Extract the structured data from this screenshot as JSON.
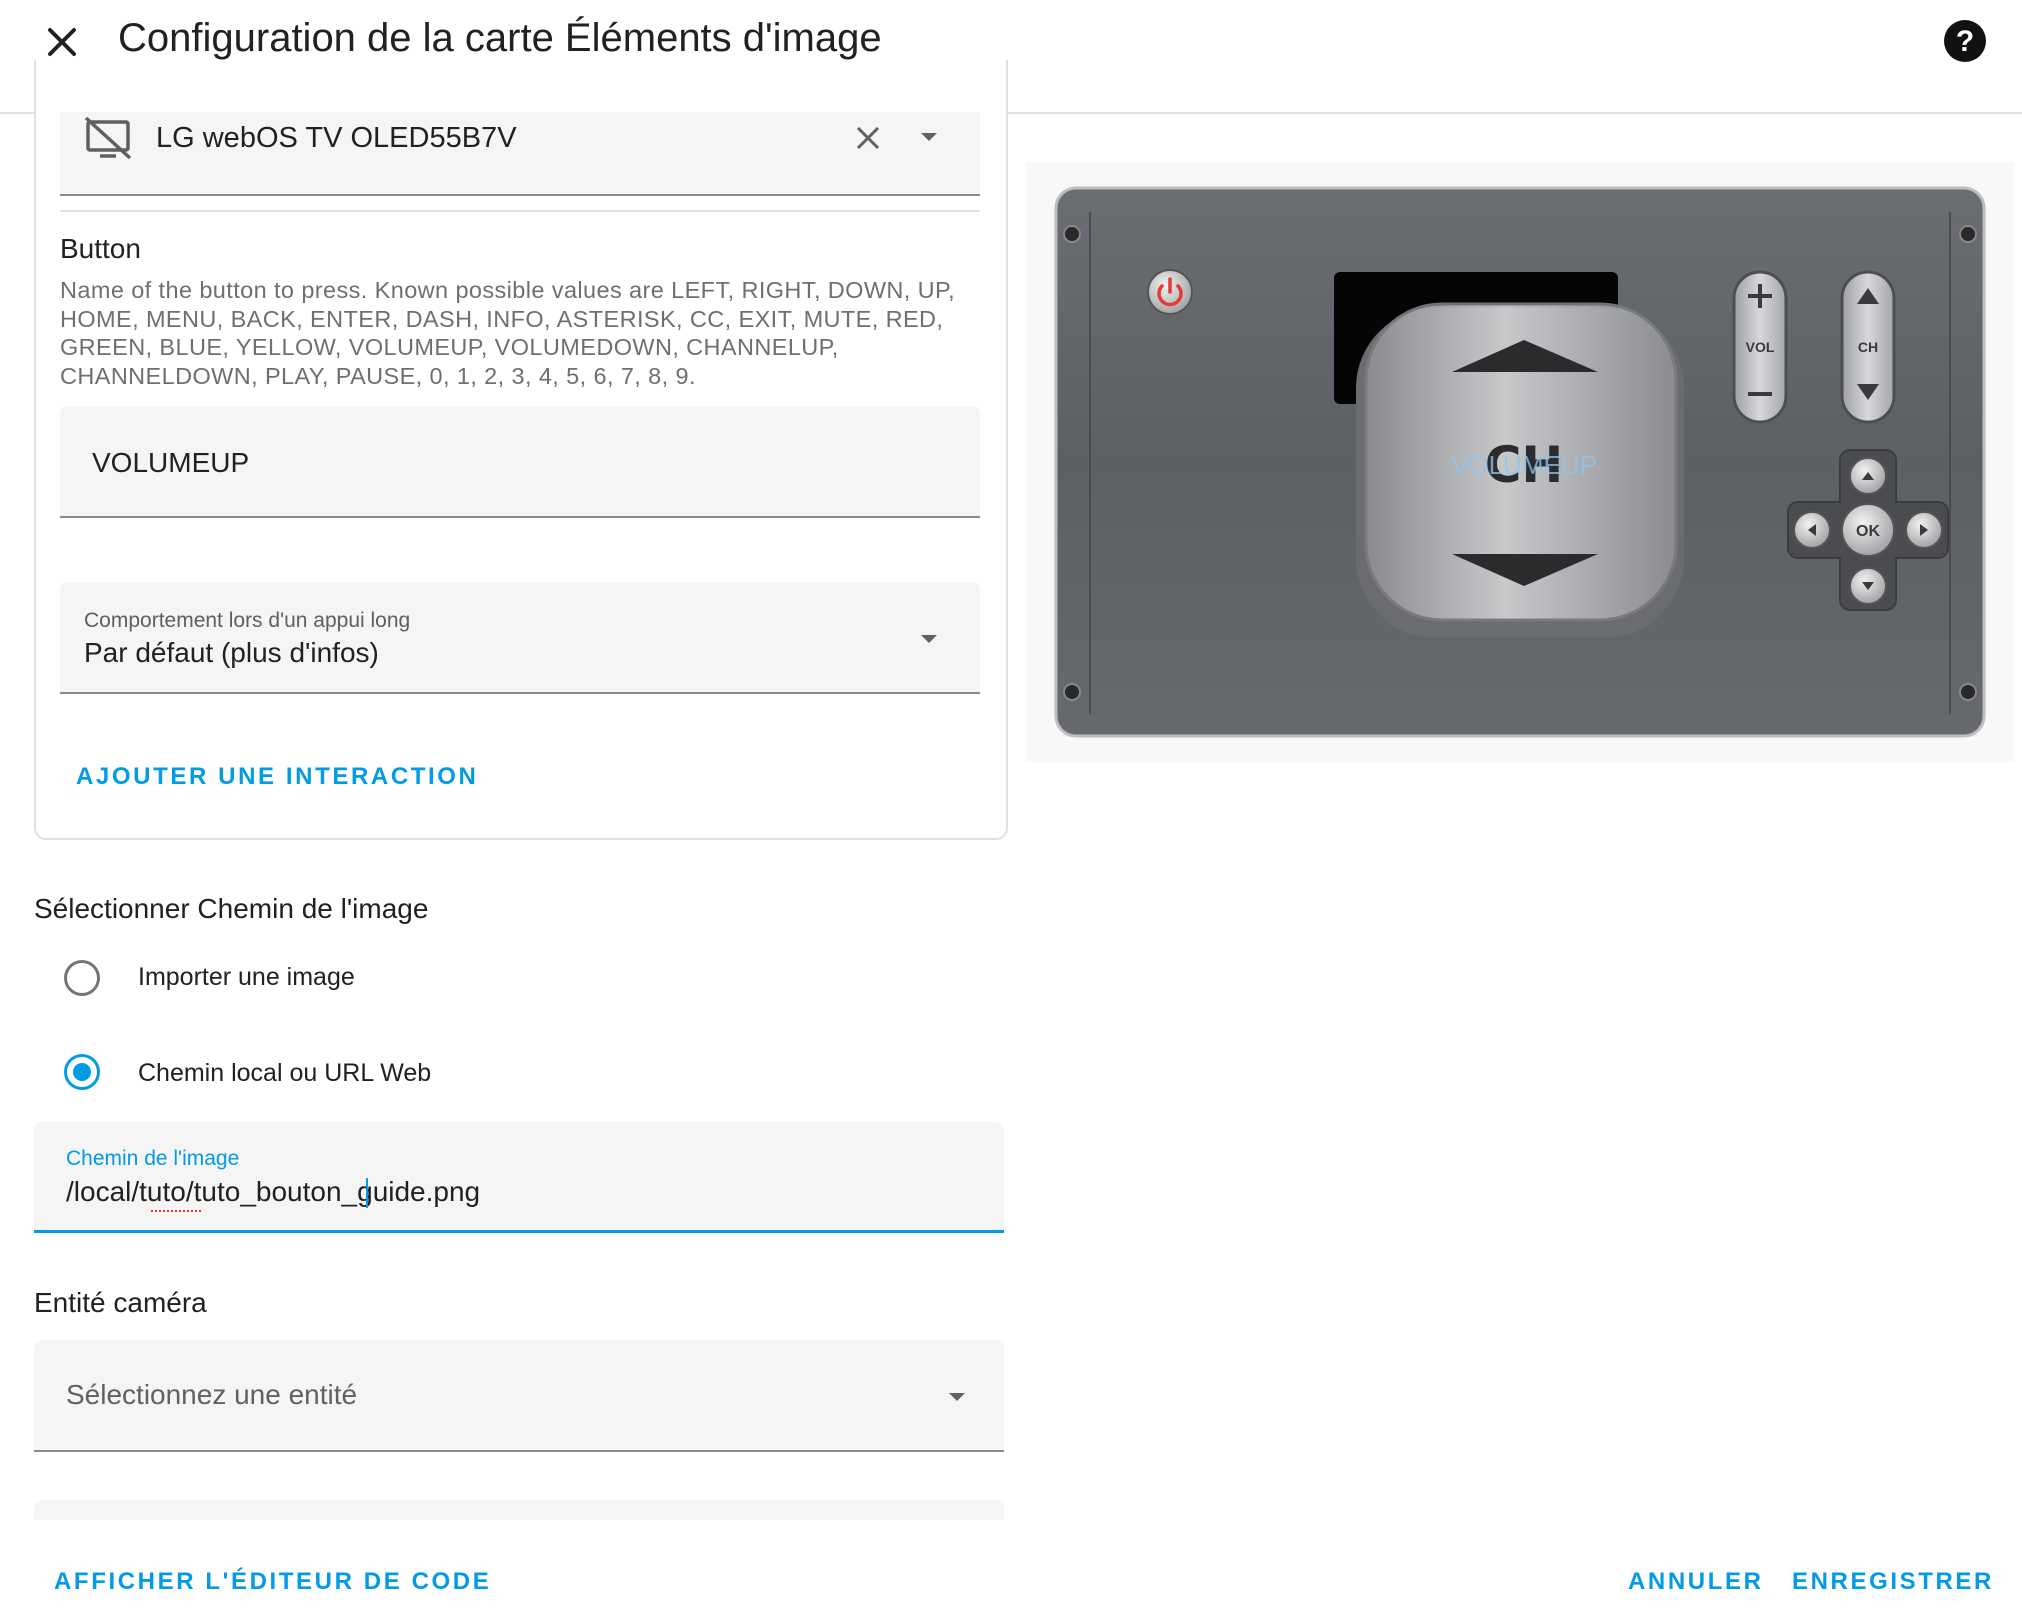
{
  "dialog": {
    "title": "Configuration de la carte Éléments d'image"
  },
  "action_card": {
    "entity_value": "LG webOS TV OLED55B7V",
    "button_heading": "Button",
    "button_description": "Name of the button to press. Known possible values are LEFT, RIGHT, DOWN, UP, HOME, MENU, BACK, ENTER, DASH, INFO, ASTERISK, CC, EXIT, MUTE, RED, GREEN, BLUE, YELLOW, VOLUMEUP, VOLUMEDOWN, CHANNELUP, CHANNELDOWN, PLAY, PAUSE, 0, 1, 2, 3, 4, 5, 6, 7, 8, 9.",
    "button_value": "VOLUMEUP",
    "hold_label": "Comportement lors d'un appui long",
    "hold_value": "Par défaut (plus d'infos)",
    "add_interaction": "AJOUTER UNE INTERACTION"
  },
  "image_source": {
    "heading": "Sélectionner Chemin de l'image",
    "options": [
      {
        "label": "Importer une image",
        "selected": false
      },
      {
        "label": "Chemin local ou URL Web",
        "selected": true
      }
    ],
    "path_label": "Chemin de l'image",
    "path_value": "/local/tuto/tuto_bouton_guide.png"
  },
  "camera": {
    "heading": "Entité caméra",
    "placeholder": "Sélectionnez une entité"
  },
  "footer": {
    "show_code": "AFFICHER L'ÉDITEUR DE CODE",
    "cancel": "ANNULER",
    "save": "ENREGISTRER"
  },
  "preview": {
    "vol_label": "VOL",
    "ch_label": "CH",
    "ok_label": "OK",
    "big_ch_label": "CH",
    "overlay_text": "VOLUMEUP"
  },
  "colors": {
    "accent": "#039be5",
    "power": "#e53935"
  },
  "icons": {
    "close": "close-icon",
    "help": "help-circle-icon",
    "entity": "television-off-icon",
    "clear": "close-icon",
    "dropdown": "menu-down-icon"
  }
}
